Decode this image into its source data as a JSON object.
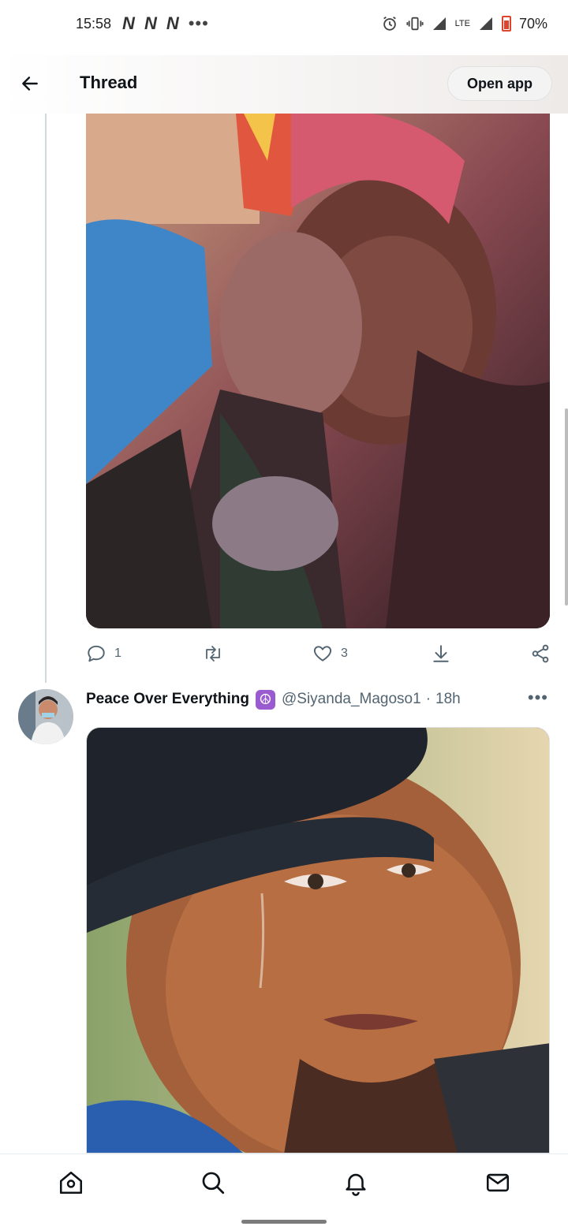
{
  "status_bar": {
    "time": "15:58",
    "notifications": [
      "N",
      "N",
      "N"
    ],
    "more": "•••",
    "network": "LTE",
    "battery": "70%"
  },
  "header": {
    "title": "Thread",
    "open_app": "Open app"
  },
  "tweet1": {
    "media_icon": "photo-crying-woman",
    "actions": {
      "reply_count": "1",
      "retweet_count": "",
      "like_count": "3"
    }
  },
  "tweet2": {
    "display_name": "Peace Over Everything",
    "badge": "☮",
    "handle": "@Siyanda_Magoso1",
    "separator": "·",
    "time": "18h",
    "more": "•••",
    "media_icon": "photo-crying-man-beret"
  },
  "bottom_nav": {
    "items": [
      "home-icon",
      "search-icon",
      "notifications-icon",
      "messages-icon"
    ]
  }
}
